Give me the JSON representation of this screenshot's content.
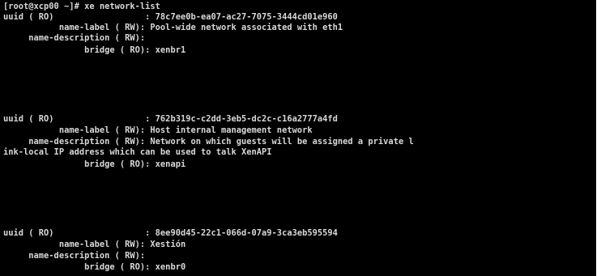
{
  "terminal": {
    "lines": [
      "[root@xcp00 ~]# xe network-list",
      "uuid ( RO)                  : 78c7ee0b-ea07-ac27-7075-3444cd01e960",
      "           name-label ( RW): Pool-wide network associated with eth1",
      "     name-description ( RW): ",
      "                bridge ( RO): xenbr1",
      "",
      "",
      "uuid ( RO)                  : 762b319c-c2dd-3eb5-dc2c-c16a2777a4fd",
      "           name-label ( RW): Host internal management network",
      "     name-description ( RW): Network on which guests will be assigned a private l",
      "ink-local IP address which can be used to talk XenAPI",
      "                bridge ( RO): xenapi",
      "",
      "",
      "uuid ( RO)                  : 8ee90d45-22c1-066d-07a9-3ca3eb595594",
      "           name-label ( RW): Xestión",
      "     name-description ( RW): ",
      "                bridge ( RO): xenbr0"
    ],
    "colors": {
      "background": "#000000",
      "foreground": "#d8d8d8"
    }
  }
}
